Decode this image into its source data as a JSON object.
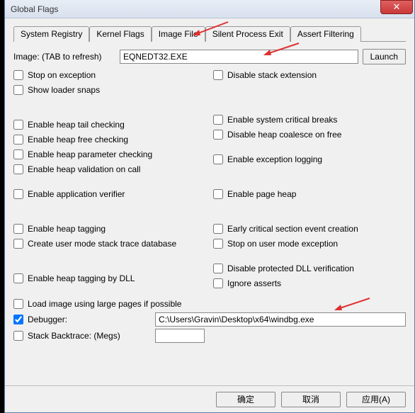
{
  "window": {
    "title": "Global Flags",
    "close": "✕"
  },
  "tabs": [
    {
      "label": "System Registry"
    },
    {
      "label": "Kernel Flags"
    },
    {
      "label": "Image File"
    },
    {
      "label": "Silent Process Exit"
    },
    {
      "label": "Assert Filtering"
    }
  ],
  "active_tab_index": 2,
  "image": {
    "label": "Image: (TAB to refresh)",
    "value": "EQNEDT32.EXE",
    "launch": "Launch"
  },
  "left": {
    "stop_on_exception": "Stop on exception",
    "show_loader_snaps": "Show loader snaps",
    "enable_heap_tail": "Enable heap tail checking",
    "enable_heap_free": "Enable heap free checking",
    "enable_heap_param": "Enable heap parameter checking",
    "enable_heap_valid": "Enable heap validation on call",
    "enable_app_verifier": "Enable application verifier",
    "enable_heap_tagging": "Enable heap tagging",
    "create_stack_trace": "Create user mode stack trace database",
    "enable_heap_tag_dll": "Enable heap tagging by DLL"
  },
  "right": {
    "disable_stack_ext": "Disable stack extension",
    "enable_sys_crit": "Enable system critical breaks",
    "disable_heap_coal": "Disable heap coalesce on free",
    "enable_except_log": "Enable exception logging",
    "enable_page_heap": "Enable page heap",
    "early_crit": "Early critical section event creation",
    "stop_user_except": "Stop on user mode exception",
    "disable_prot_dll": "Disable protected DLL verification",
    "ignore_asserts": "Ignore asserts"
  },
  "bottom": {
    "load_large_pages": "Load image using large pages if possible",
    "debugger_label": "Debugger:",
    "debugger_value": "C:\\Users\\Gravin\\Desktop\\x64\\windbg.exe",
    "debugger_checked": true,
    "stack_backtrace": "Stack Backtrace: (Megs)",
    "stack_value": ""
  },
  "footer": {
    "ok": "确定",
    "cancel": "取消",
    "apply": "应用(A)"
  },
  "annotation_color": "#e03030"
}
